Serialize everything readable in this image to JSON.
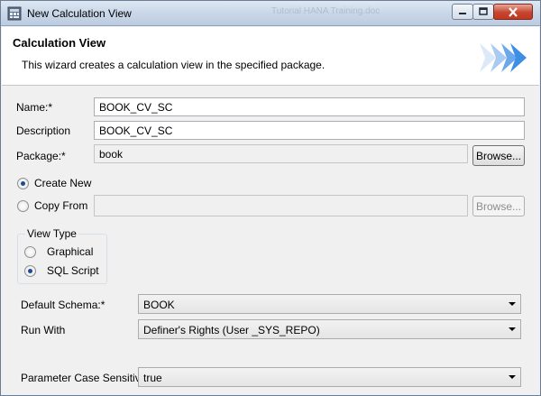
{
  "window": {
    "title": "New Calculation View",
    "background_title_fragment": "Tutorial HANA Training.doc"
  },
  "header": {
    "title": "Calculation View",
    "description": "This wizard creates a calculation view in the specified package."
  },
  "form": {
    "name_label": "Name:*",
    "name_value": "BOOK_CV_SC",
    "description_label": "Description",
    "description_value": "BOOK_CV_SC",
    "package_label": "Package:*",
    "package_value": "book",
    "browse_label": "Browse...",
    "create_new_label": "Create New",
    "copy_from_label": "Copy From",
    "copy_from_value": "",
    "copy_browse_label": "Browse..."
  },
  "view_type": {
    "title": "View Type",
    "graphical_label": "Graphical",
    "sql_script_label": "SQL Script",
    "selected": "SQL Script"
  },
  "options": {
    "default_schema_label": "Default Schema:*",
    "default_schema_value": "BOOK",
    "run_with_label": "Run With",
    "run_with_value": "Definer's Rights (User _SYS_REPO)",
    "param_case_label": "Parameter Case Sensitive",
    "param_case_value": "true"
  },
  "colors": {
    "accent": "#3d8ee5",
    "title_gradient_top": "#dfe8f3",
    "close_button": "#c6452f"
  }
}
